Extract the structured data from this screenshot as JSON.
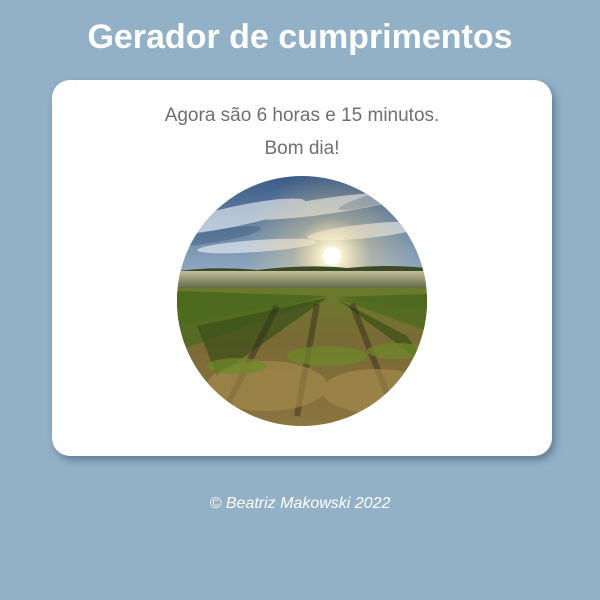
{
  "header": {
    "title": "Gerador de cumprimentos"
  },
  "card": {
    "time_text": "Agora são 6 horas e 15 minutos.",
    "greeting": "Bom dia!",
    "image": "sunrise-vineyard-photo"
  },
  "footer": {
    "copyright": "© Beatriz Makowski 2022"
  },
  "colors": {
    "background": "#92b1c7",
    "card": "#ffffff",
    "text": "#6f6f6f"
  }
}
